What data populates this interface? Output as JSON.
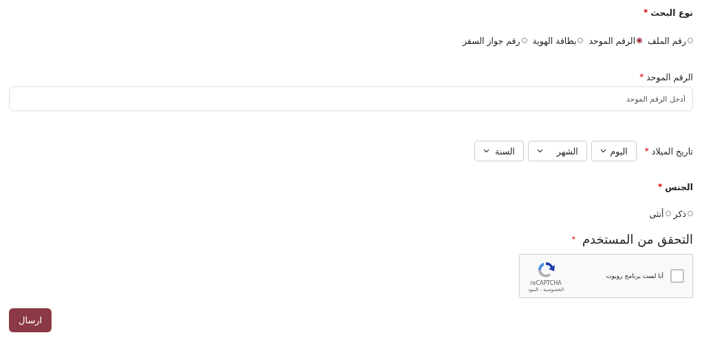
{
  "search_type": {
    "label": "نوع البحث",
    "required": "*",
    "options": [
      {
        "label": "رقم الملف",
        "selected": false
      },
      {
        "label": "الرقم الموحد",
        "selected": true
      },
      {
        "label": "بطاقة الهوية",
        "selected": false
      },
      {
        "label": "رقم جواز السفر",
        "selected": false
      }
    ]
  },
  "unified_number": {
    "label": "الرقم الموحد",
    "required": "*",
    "placeholder": "أدخل الرقم الموحد"
  },
  "birth_date": {
    "label": "تاريخ الميلاد",
    "required": "*",
    "selects": [
      {
        "placeholder": "اليوم"
      },
      {
        "placeholder": "الشهر"
      },
      {
        "placeholder": "السنة"
      }
    ]
  },
  "gender": {
    "label": "الجنس",
    "required": "*",
    "options": [
      {
        "label": "ذكر",
        "selected": false
      },
      {
        "label": "أنثى",
        "selected": false
      }
    ]
  },
  "captcha": {
    "title": "التحقق من المستخدم",
    "required": "*",
    "checkbox_label": "أنا لست برنامج روبوت",
    "checked": false,
    "brand": "reCAPTCHA",
    "links": "الخصوصية - البنود"
  },
  "submit": "ارسال"
}
